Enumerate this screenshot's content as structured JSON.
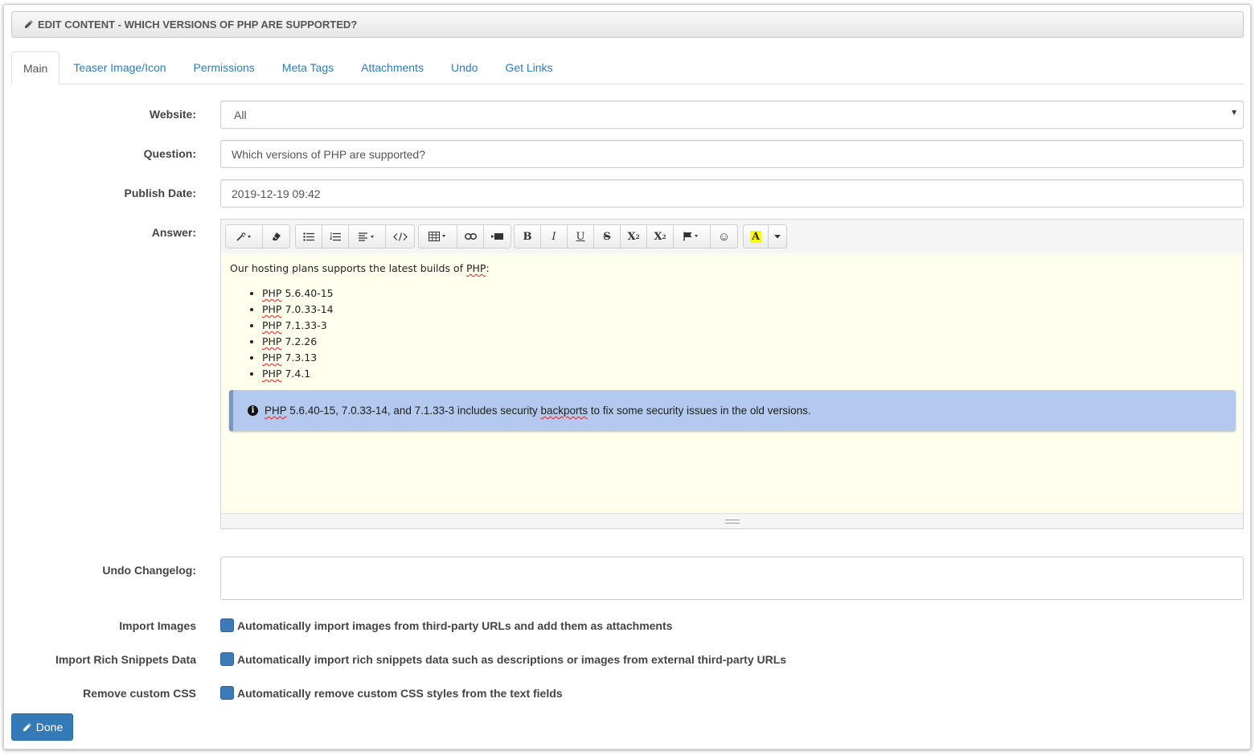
{
  "title": "Edit Content - Which versions of PHP are supported?",
  "tabs": [
    {
      "label": "Main",
      "active": true
    },
    {
      "label": "Teaser Image/Icon",
      "active": false
    },
    {
      "label": "Permissions",
      "active": false
    },
    {
      "label": "Meta Tags",
      "active": false
    },
    {
      "label": "Attachments",
      "active": false
    },
    {
      "label": "Undo",
      "active": false
    },
    {
      "label": "Get Links",
      "active": false
    }
  ],
  "form": {
    "website_label": "Website:",
    "website_value": "All",
    "question_label": "Question:",
    "question_value": "Which versions of PHP are supported?",
    "publish_label": "Publish Date:",
    "publish_value": "2019-12-19 09:42",
    "answer_label": "Answer:",
    "undo_label": "Undo Changelog:",
    "undo_value": ""
  },
  "toolbar": {
    "icons": [
      "magic-wand-icon",
      "eraser-icon",
      "unordered-list-icon",
      "ordered-list-icon",
      "align-icon",
      "code-view-icon",
      "table-icon",
      "link-icon",
      "video-icon",
      "bold-icon",
      "italic-icon",
      "underline-icon",
      "strikethrough-icon",
      "superscript-icon",
      "subscript-icon",
      "flag-icon",
      "emoji-icon",
      "highlight-icon",
      "more-options-icon"
    ],
    "highlight_color": "#ffff00"
  },
  "answer": {
    "intro_prefix": "Our hosting plans supports the latest builds of ",
    "intro_php": "PHP",
    "intro_suffix": ":",
    "items": [
      {
        "php": "PHP",
        "version": " 5.6.40-15"
      },
      {
        "php": "PHP",
        "version": " 7.0.33-14"
      },
      {
        "php": "PHP",
        "version": " 7.1.33-3"
      },
      {
        "php": "PHP",
        "version": " 7.2.26"
      },
      {
        "php": "PHP",
        "version": " 7.3.13"
      },
      {
        "php": "PHP",
        "version": " 7.4.1"
      }
    ],
    "callout": {
      "php": "PHP",
      "part1": " 5.6.40-15, 7.0.33-14, and 7.1.33-3 includes security ",
      "backports": "backports",
      "part2": " to fix some security issues in the old versions."
    }
  },
  "options": [
    {
      "label": "Import Images",
      "text": "Automatically import images from third-party URLs and add them as attachments"
    },
    {
      "label": "Import Rich Snippets Data",
      "text": "Automatically import rich snippets data such as descriptions or images from external third-party URLs"
    },
    {
      "label": "Remove custom CSS",
      "text": "Automatically remove custom CSS styles from the text fields"
    }
  ],
  "done_label": "Done",
  "colors": {
    "primary": "#337ab7",
    "callout_bg": "#b4c9ee",
    "editor_bg": "#ffffee"
  }
}
